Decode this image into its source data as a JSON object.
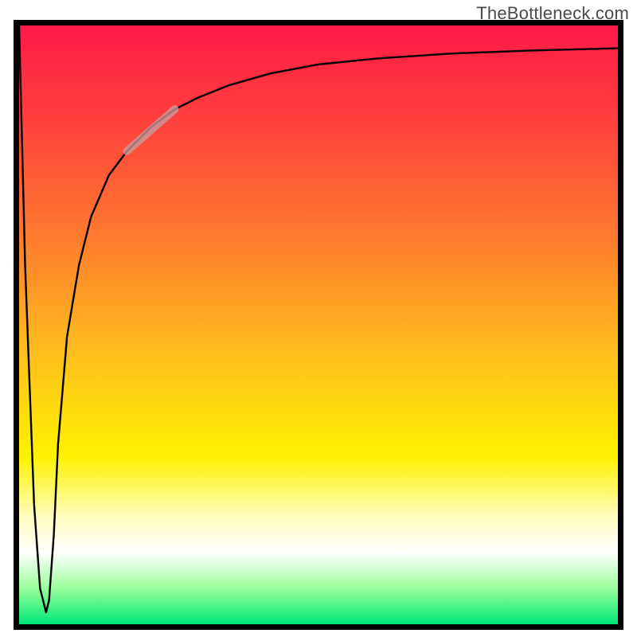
{
  "watermark": "TheBottleneck.com",
  "chart_data": {
    "type": "line",
    "title": "",
    "xlabel": "",
    "ylabel": "",
    "xlim": [
      0,
      100
    ],
    "ylim": [
      0,
      100
    ],
    "grid": false,
    "series": [
      {
        "name": "curve",
        "color": "#000000",
        "x": [
          0.0,
          1.0,
          2.5,
          3.5,
          4.5,
          5.0,
          5.8,
          6.5,
          8.0,
          10.0,
          12.0,
          15.0,
          18.0,
          22.0,
          26.0,
          30.0,
          35.0,
          42.0,
          50.0,
          60.0,
          72.0,
          85.0,
          100.0
        ],
        "y": [
          100.0,
          60.0,
          20.0,
          6.0,
          2.0,
          4.0,
          15.0,
          30.0,
          48.0,
          60.0,
          68.0,
          75.0,
          79.0,
          83.0,
          86.0,
          88.0,
          90.0,
          92.0,
          93.5,
          94.5,
          95.3,
          95.8,
          96.2
        ]
      },
      {
        "name": "highlight-segment",
        "color": "#c99a9a",
        "x": [
          18.0,
          26.0
        ],
        "y": [
          79.0,
          86.0
        ]
      }
    ],
    "background_gradient_stops": [
      {
        "pos": 0.0,
        "color": "#ff1a47"
      },
      {
        "pos": 0.15,
        "color": "#ff3e3e"
      },
      {
        "pos": 0.35,
        "color": "#ff7a2e"
      },
      {
        "pos": 0.55,
        "color": "#ffbf1d"
      },
      {
        "pos": 0.72,
        "color": "#fff200"
      },
      {
        "pos": 0.82,
        "color": "#fffcbe"
      },
      {
        "pos": 0.88,
        "color": "#ffffff"
      },
      {
        "pos": 0.94,
        "color": "#9aff9a"
      },
      {
        "pos": 1.0,
        "color": "#00e676"
      }
    ]
  }
}
